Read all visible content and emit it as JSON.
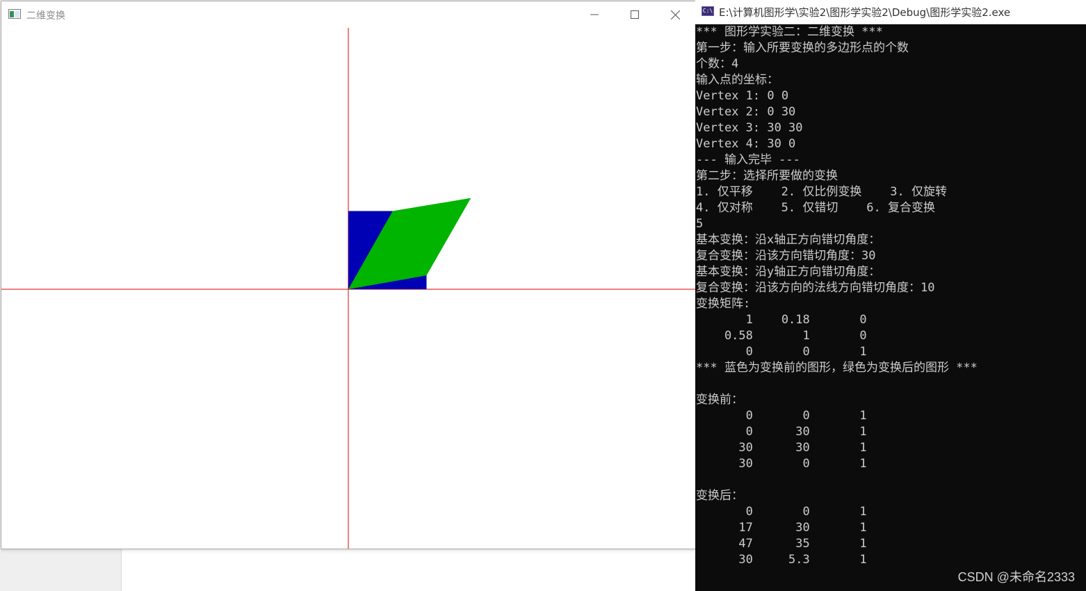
{
  "graphics_window": {
    "title": "二维变换",
    "buttons": {
      "minimize": "minimize",
      "maximize": "maximize",
      "close": "close"
    },
    "colors": {
      "axis": "#dd0000",
      "original": "#0000b4",
      "transformed": "#00b400"
    },
    "original_polygon": [
      [
        0,
        0
      ],
      [
        0,
        30
      ],
      [
        30,
        30
      ],
      [
        30,
        0
      ]
    ],
    "transformed_polygon": [
      [
        0,
        0
      ],
      [
        17,
        30
      ],
      [
        47,
        35
      ],
      [
        30,
        5.3
      ]
    ]
  },
  "console_window": {
    "title": "E:\\计算机图形学\\实验2\\图形学实验2\\Debug\\图形学实验2.exe",
    "lines": [
      "*** 图形学实验二：二维变换 ***",
      "第一步：输入所要变换的多边形点的个数",
      "个数：4",
      "输入点的坐标：",
      "Vertex 1: 0 0",
      "Vertex 2: 0 30",
      "Vertex 3: 30 30",
      "Vertex 4: 30 0",
      "--- 输入完毕 ---",
      "第二步：选择所要做的变换",
      "1. 仅平移    2. 仅比例变换    3. 仅旋转",
      "4. 仅对称    5. 仅错切    6. 复合变换",
      "5",
      "基本变换：沿x轴正方向错切角度：",
      "复合变换：沿该方向错切角度：30",
      "基本变换：沿y轴正方向错切角度：",
      "复合变换：沿该方向的法线方向错切角度：10",
      "变换矩阵:",
      "       1    0.18       0",
      "    0.58       1       0",
      "       0       0       1",
      "*** 蓝色为变换前的图形，绿色为变换后的图形 ***",
      "",
      "变换前：",
      "       0       0       1",
      "       0      30       1",
      "      30      30       1",
      "      30       0       1",
      "",
      "变换后：",
      "       0       0       1",
      "      17      30       1",
      "      47      35       1",
      "      30     5.3       1"
    ],
    "watermark": "CSDN @未命名2333"
  }
}
